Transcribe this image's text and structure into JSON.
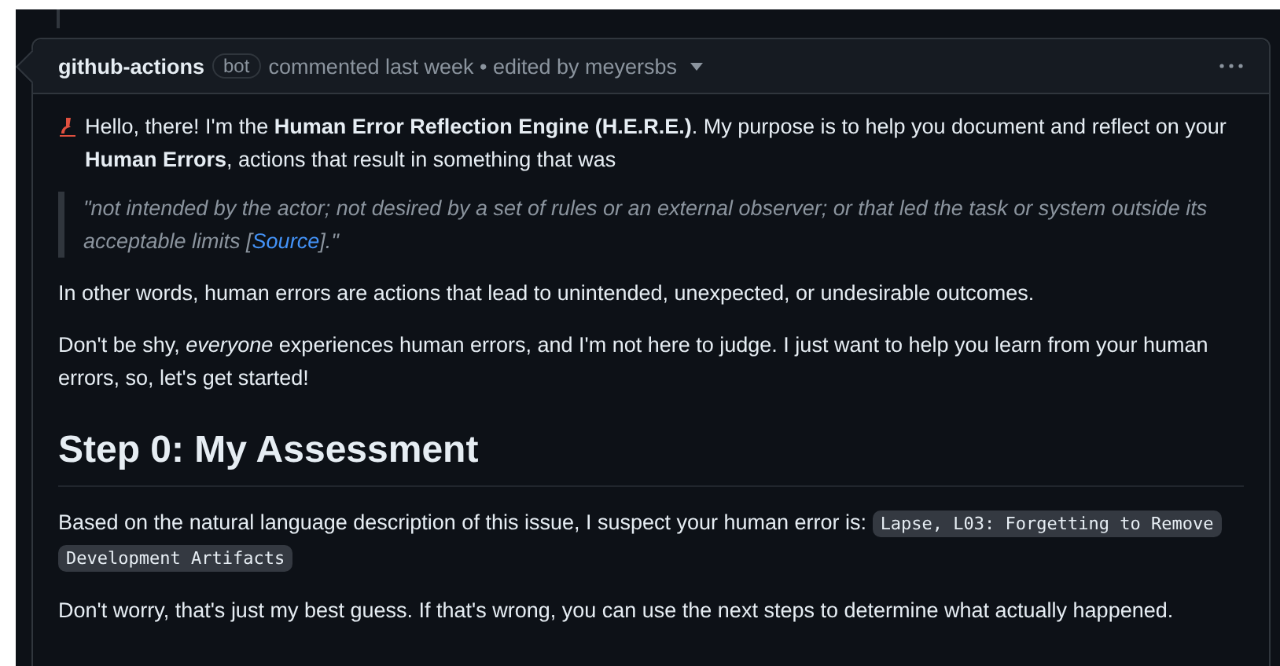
{
  "comment": {
    "author": "github-actions",
    "badge": "bot",
    "meta": "commented last week • edited by meyersbs",
    "intro": "Hello, there! I'm the **Human Error Reflection Engine (H.E.R.E.)**. My purpose is to help you document and reflect on your **Human Errors**, actions that result in something that was",
    "quote": {
      "before": "\"not intended by the actor; not desired by a set of rules or an external observer; or that led the task or system outside its acceptable limits [",
      "link": "Source",
      "after": "].\""
    },
    "paragraphs": [
      "In other words, human errors are actions that lead to unintended, unexpected, or undesirable outcomes.",
      "Don't be shy, *everyone* experiences human errors, and I'm not here to judge. I just want to help you learn from your human errors, so, let's get started!"
    ],
    "heading": "Step 0: My Assessment",
    "assessment": {
      "text": "Based on the natural language description of this issue, I suspect your human error is:",
      "code": [
        "Lapse, L03: Forgetting to Remove",
        "Development Artifacts"
      ]
    },
    "closing": "Don't worry, that's just my best guess. If that's wrong, you can use the next steps to determine what actually happened."
  }
}
